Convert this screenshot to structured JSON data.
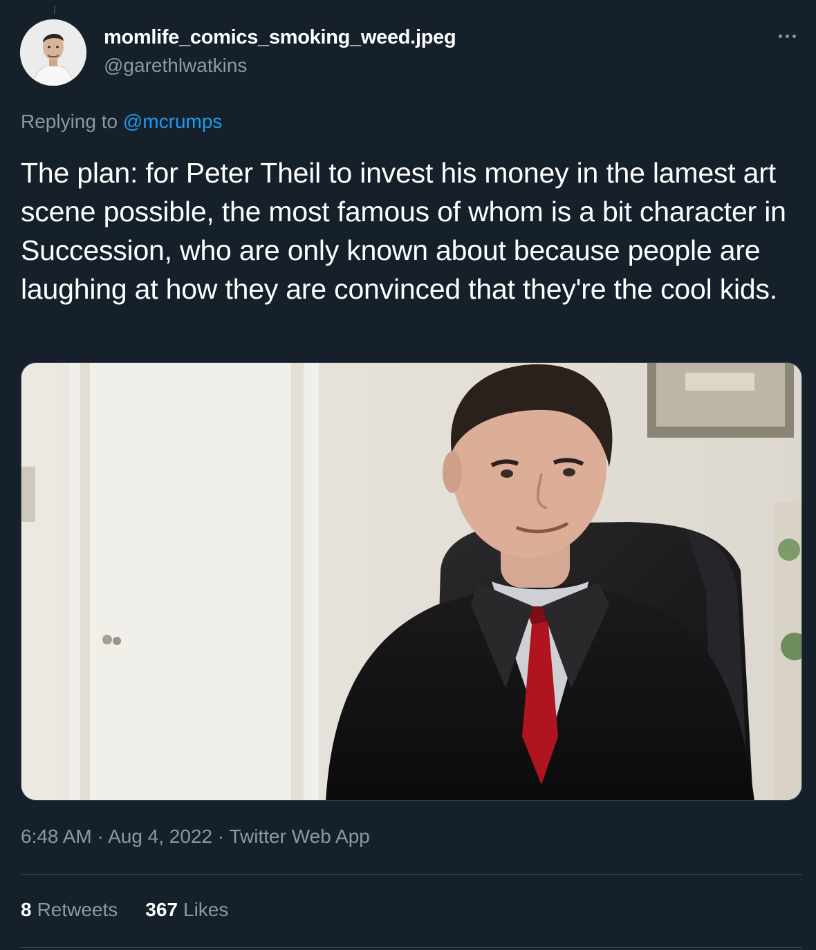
{
  "tweet": {
    "author": {
      "display_name": "momlife_comics_smoking_weed.jpeg",
      "handle": "@garethlwatkins"
    },
    "replying_to": {
      "prefix": "Replying to",
      "mention": "@mcrumps"
    },
    "text": "The plan: for Peter Theil to invest his money in the lamest art scene possible, the most famous of whom is a bit character in Succession, who are only known about because people are laughing at how they are convinced that they're the cool kids.",
    "meta": {
      "time": "6:48 AM",
      "separator": "·",
      "date": "Aug 4, 2022",
      "source": "Twitter Web App"
    },
    "stats": {
      "retweets": {
        "count": "8",
        "label": "Retweets"
      },
      "likes": {
        "count": "367",
        "label": "Likes"
      }
    }
  },
  "colors": {
    "background": "#15202b",
    "text_primary": "#ffffff",
    "text_secondary": "#8b98a5",
    "accent": "#1d9bf0",
    "divider": "#38444d"
  },
  "icons": {
    "more": "more-horizontal-icon"
  }
}
